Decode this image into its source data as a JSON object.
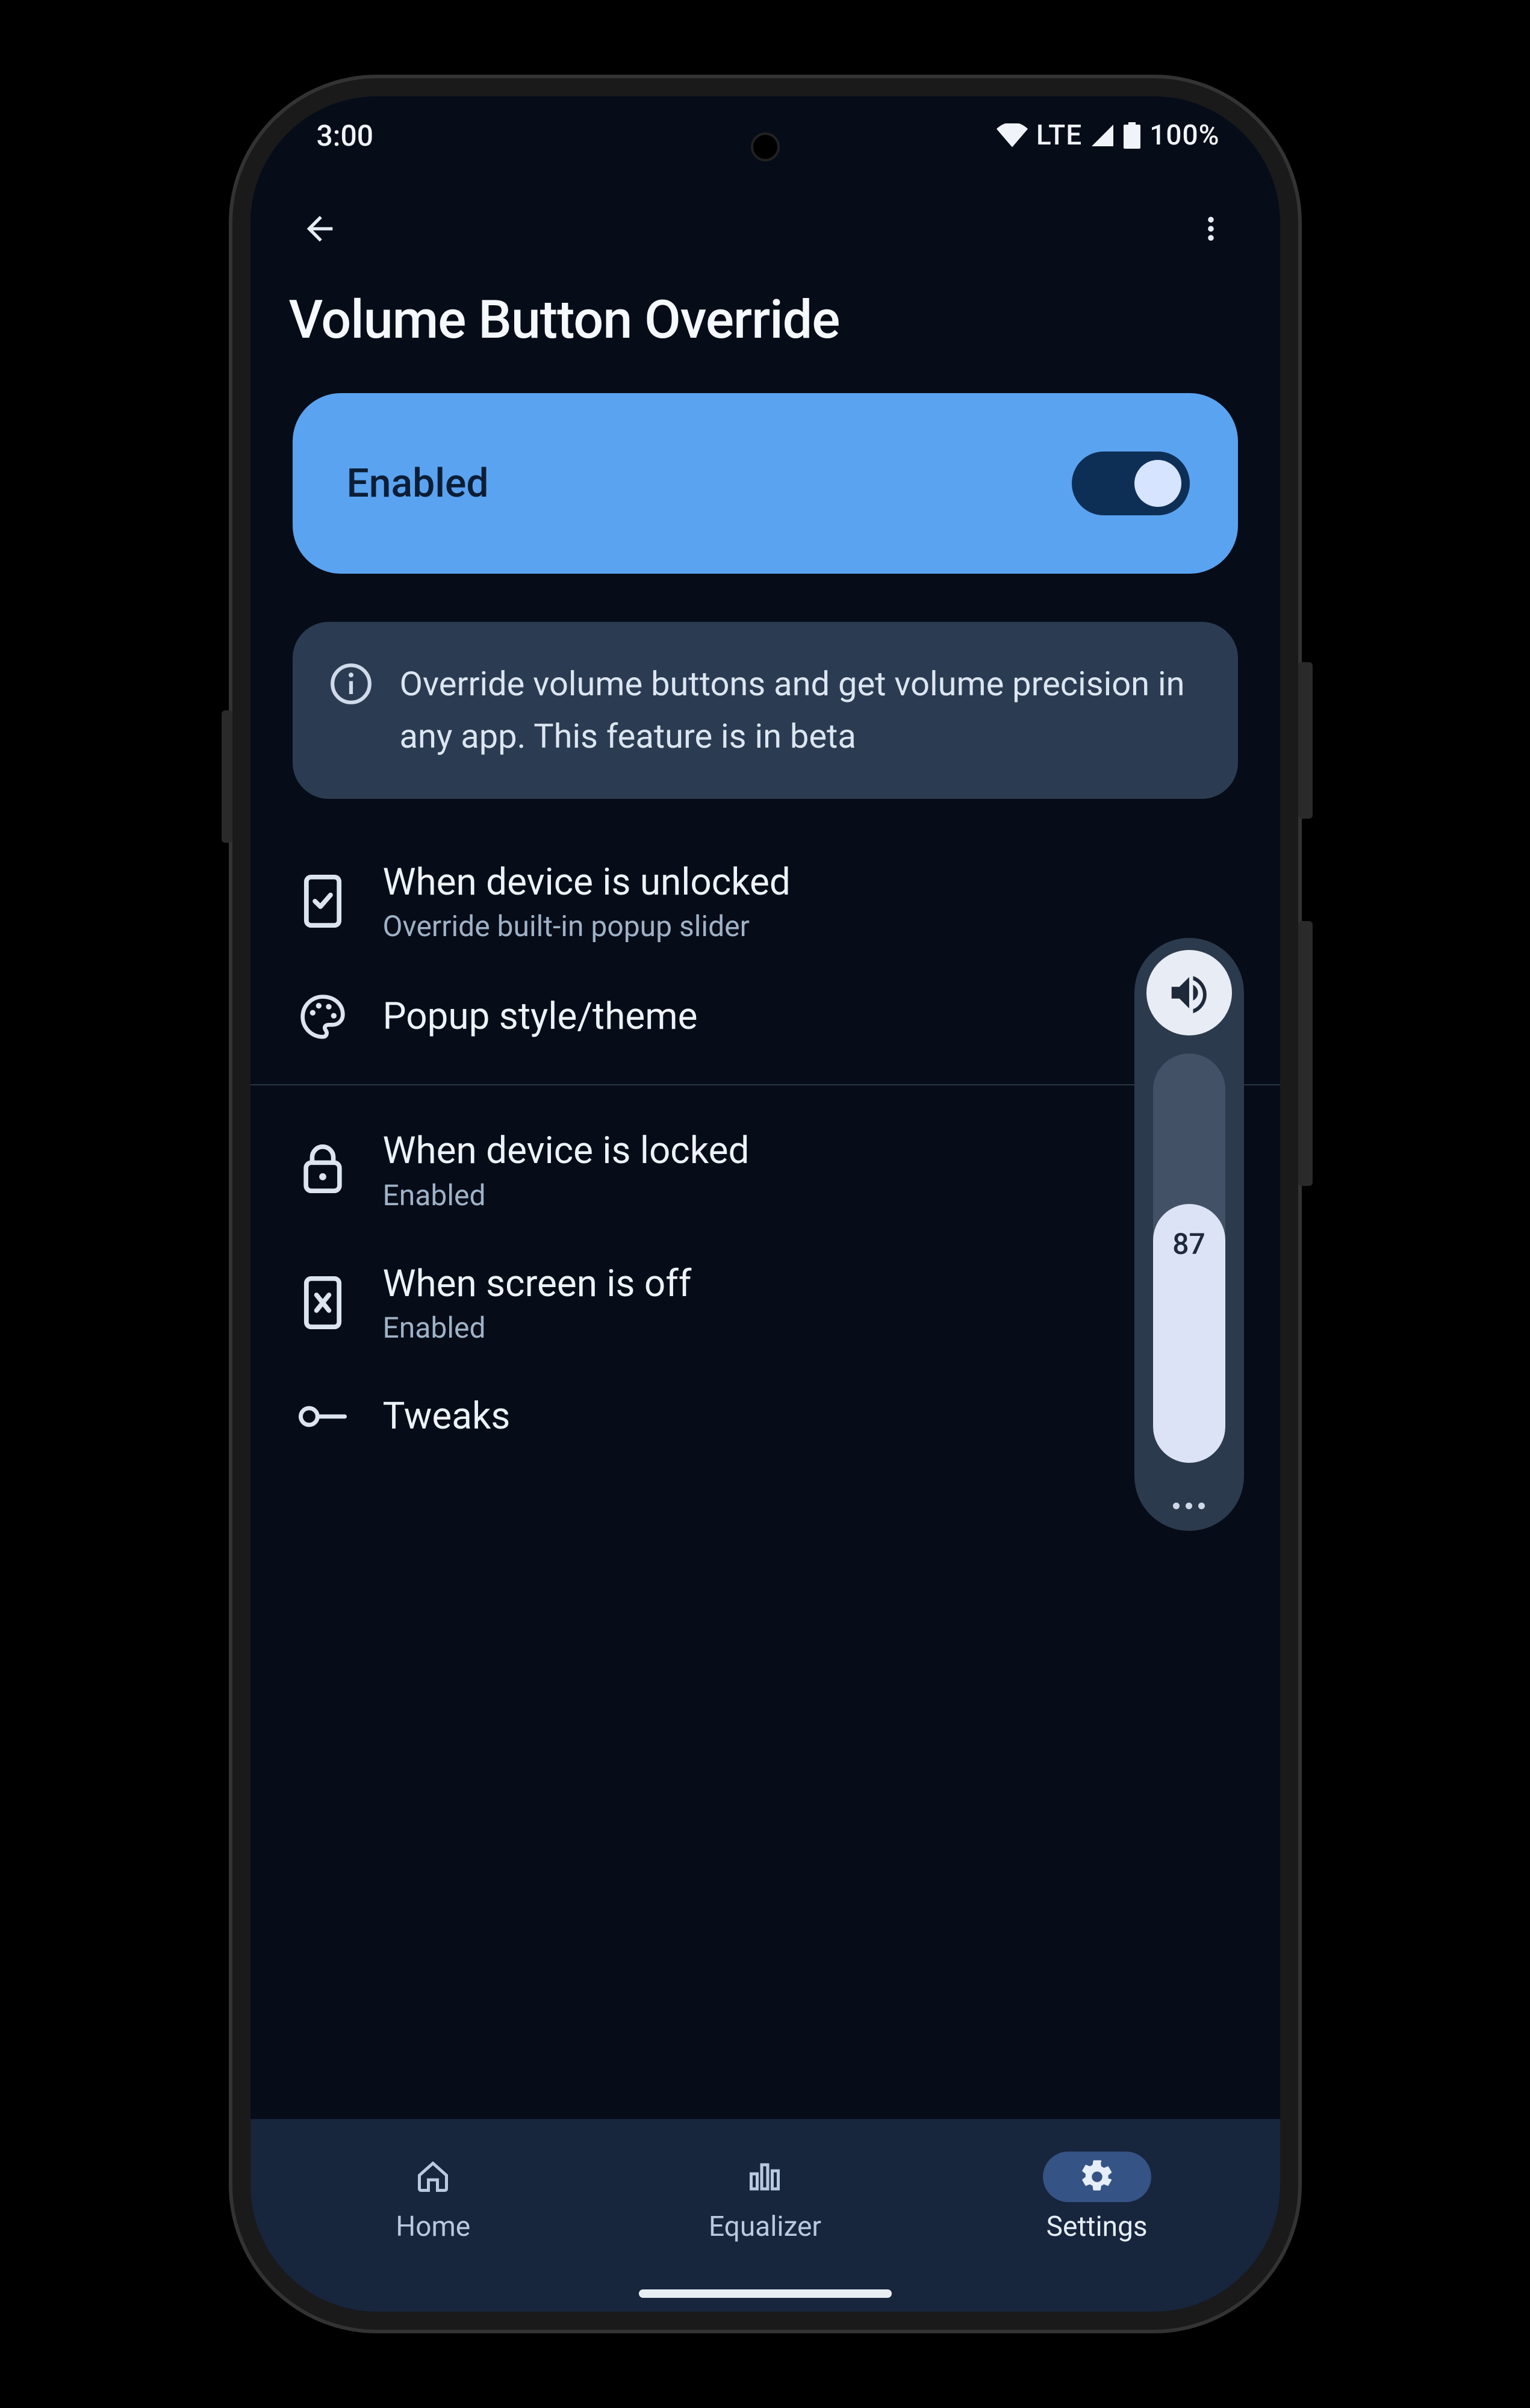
{
  "status": {
    "time": "3:00",
    "network_label": "LTE",
    "battery_label": "100%"
  },
  "header": {
    "title": "Volume Button Override"
  },
  "enable_card": {
    "label": "Enabled",
    "switch_on": true
  },
  "info": {
    "text": "Override volume buttons and get volume precision in any app. This feature is in beta"
  },
  "items": {
    "unlocked": {
      "title": "When device is unlocked",
      "subtitle": "Override built-in popup slider"
    },
    "popup_style": {
      "title": "Popup style/theme"
    },
    "locked": {
      "title": "When device is locked",
      "subtitle": "Enabled"
    },
    "screen_off": {
      "title": "When screen is off",
      "subtitle": "Enabled"
    },
    "tweaks": {
      "title": "Tweaks"
    }
  },
  "volume_popup": {
    "value": "87"
  },
  "nav": {
    "home": "Home",
    "equalizer": "Equalizer",
    "settings": "Settings",
    "active": "settings"
  }
}
